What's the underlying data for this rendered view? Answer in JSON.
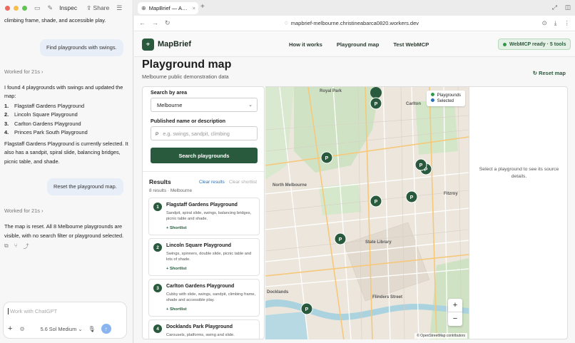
{
  "chat": {
    "tab_title": "Inspec",
    "share_label": "Share",
    "intro_text": "climbing frame, shade, and accessible play.",
    "user_msg_1": "Find playgrounds with swings.",
    "worked_1": "Worked for 21s",
    "assistant_1": "I found 4 playgrounds with swings and updated the map:",
    "found_items": [
      {
        "num": "1.",
        "label": "Flagstaff Gardens Playground"
      },
      {
        "num": "2.",
        "label": "Lincoln Square Playground"
      },
      {
        "num": "3.",
        "label": "Carlton Gardens Playground"
      },
      {
        "num": "4.",
        "label": "Princes Park South Playground"
      }
    ],
    "assistant_1b": "Flagstaff Gardens Playground is currently selected. It also has a sandpit, spiral slide, balancing bridges, picnic table, and shade.",
    "user_msg_2": "Reset the playground map.",
    "worked_2": "Worked for 21s",
    "assistant_2": "The map is reset. All 8 Melbourne playgrounds are visible, with no search filter or playground selected.",
    "composer_placeholder": "Work with ChatGPT",
    "model_label": "5.6 Sol",
    "effort_label": "Medium"
  },
  "browser": {
    "tab_title": "MapBrief — A…",
    "url": "mapbrief-melbourne.christineabarca0820.workers.dev"
  },
  "site": {
    "brand": "MapBrief",
    "nav": [
      "How it works",
      "Playground map",
      "Test WebMCP"
    ],
    "status_badge": "WebMCP ready · 5 tools",
    "page_title": "Playground map",
    "page_subtitle": "Melbourne public demonstration data",
    "reset_label": "Reset map",
    "search_area_label": "Search by area",
    "area_value": "Melbourne",
    "desc_label": "Published name or description",
    "search_placeholder": "e.g. swings, sandpit, climbing",
    "search_button": "Search playgrounds",
    "results_title": "Results",
    "clear_results": "Clear results",
    "clear_shortlist": "Clear shortlist",
    "results_count": "8 results · Melbourne",
    "shortlist_label": "+ Shortlist",
    "results": [
      {
        "num": "1",
        "name": "Flagstaff Gardens Playground",
        "desc": "Sandpit, spiral slide, swings, balancing bridges, picnic table and shade."
      },
      {
        "num": "2",
        "name": "Lincoln Square Playground",
        "desc": "Swings, spinners, double slide, picnic table and lots of shade."
      },
      {
        "num": "3",
        "name": "Carlton Gardens Playground",
        "desc": "Cubby with slide, swings, sandpit, climbing frame, shade and accessible play."
      },
      {
        "num": "4",
        "name": "Docklands Park Playground",
        "desc": "Carousels, platforms, swing and slide."
      }
    ],
    "legend": {
      "playgrounds": "Playgrounds",
      "selected": "Selected"
    },
    "zoom_in": "+",
    "zoom_out": "−",
    "attribution": "© OpenStreetMap contributors",
    "map_labels": [
      "Royal Park",
      "Carlton",
      "North Melbourne",
      "Fitzroy",
      "State Library",
      "Flinders Street",
      "Docklands"
    ],
    "details_empty": "Select a playground to see its source details.",
    "marker_glyph": "P"
  },
  "colors": {
    "brand_green": "#2a5a3d",
    "legend_playground": "#2f9a4a",
    "legend_selected": "#2a6fb8"
  }
}
